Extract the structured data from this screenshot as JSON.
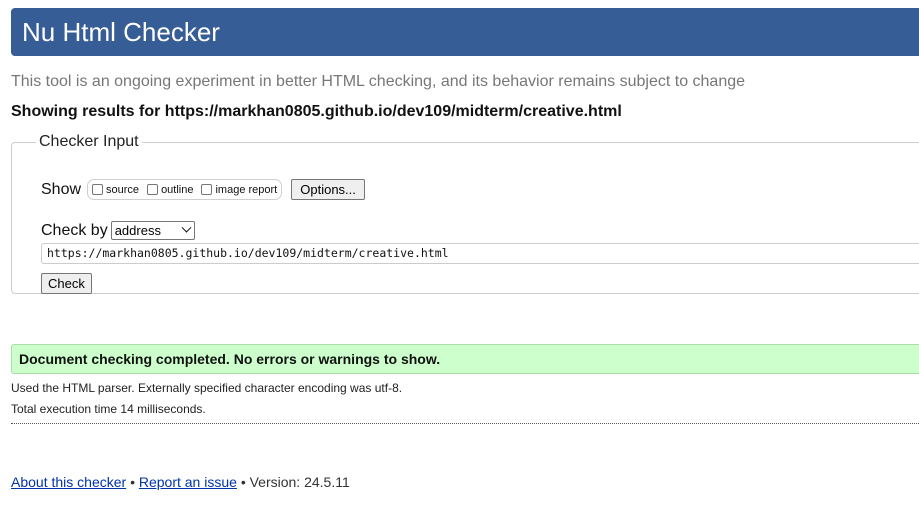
{
  "header": {
    "title": "Nu Html Checker"
  },
  "tagline": "This tool is an ongoing experiment in better HTML checking, and its behavior remains subject to change",
  "results_for": "Showing results for https://markhan0805.github.io/dev109/midterm/creative.html",
  "checker_input": {
    "legend": "Checker Input",
    "show_label": "Show",
    "show_options": [
      {
        "label": "source",
        "checked": false
      },
      {
        "label": "outline",
        "checked": false
      },
      {
        "label": "image report",
        "checked": false
      }
    ],
    "options_button": "Options...",
    "check_by_label": "Check by",
    "check_by_value": "address",
    "url_value": "https://markhan0805.github.io/dev109/midterm/creative.html",
    "check_button": "Check"
  },
  "result": {
    "message": "Document checking completed. No errors or warnings to show.",
    "parser_info": "Used the HTML parser. Externally specified character encoding was utf-8.",
    "execution_time": "Total execution time 14 milliseconds."
  },
  "footer": {
    "about_link": "About this checker",
    "separator": "•",
    "report_link": "Report an issue",
    "version": "Version: 24.5.11"
  },
  "colors": {
    "header_bg": "#365d95",
    "success_bg": "#ccffcc",
    "link": "#0033aa"
  }
}
